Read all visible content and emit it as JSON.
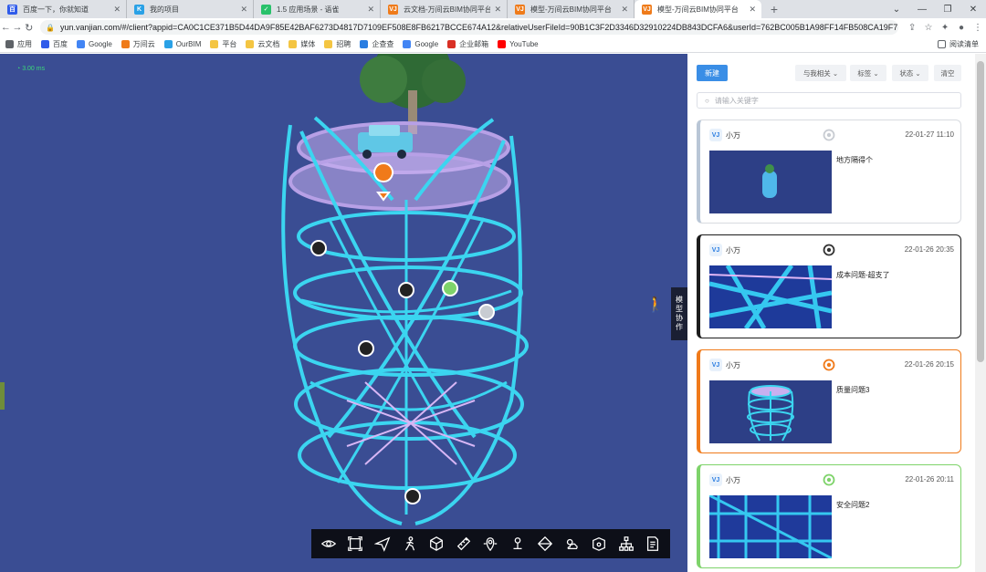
{
  "tabs": [
    {
      "title": "百度一下，你就知道",
      "fav_color": "#2f5bea",
      "fav_glyph": "百"
    },
    {
      "title": "我的项目",
      "fav_color": "#2aa1e6",
      "fav_glyph": "K"
    },
    {
      "title": "1.5 应用场景 - 语雀",
      "fav_color": "#29c16a",
      "fav_glyph": "✓"
    },
    {
      "title": "云文档-万间云BIM协同平台",
      "fav_color": "#ef7b1a",
      "fav_glyph": "VJ"
    },
    {
      "title": "模型-万间云BIM协同平台",
      "fav_color": "#ef7b1a",
      "fav_glyph": "VJ"
    },
    {
      "title": "模型-万间云BIM协同平台",
      "fav_color": "#ef7b1a",
      "fav_glyph": "VJ",
      "active": true
    }
  ],
  "address": {
    "url": "yun.vanjian.com/#/client?appid=CA0C1CE371B5D44DA9F85E42BAF6273D4817D7109EF508E8FB6217BCCE674A12&relativeUserFileId=90B1C3F2D3346D32910224DB843DCFA6&userId=762BC005B1A98FF14FB508CA19F7DB8A6..."
  },
  "bookmarks": [
    {
      "label": "应用",
      "color": "#5f6368"
    },
    {
      "label": "百度",
      "color": "#2f5bea"
    },
    {
      "label": "Google",
      "color": "#4285f4"
    },
    {
      "label": "万间云",
      "color": "#ef7b1a"
    },
    {
      "label": "OurBIM",
      "color": "#2aa1e6"
    },
    {
      "label": "平台",
      "color": "#f4c542"
    },
    {
      "label": "云文档",
      "color": "#f4c542"
    },
    {
      "label": "媒体",
      "color": "#f4c542"
    },
    {
      "label": "招聘",
      "color": "#f4c542"
    },
    {
      "label": "企查查",
      "color": "#2a7de1"
    },
    {
      "label": "Google",
      "color": "#4285f4"
    },
    {
      "label": "企业邮箱",
      "color": "#d93025"
    },
    {
      "label": "YouTube",
      "color": "#ff0000"
    }
  ],
  "reader_mode": "阅读清单",
  "viewer": {
    "fps": "3.00 ms",
    "side_tab": [
      "模",
      "型",
      "协",
      "作"
    ]
  },
  "toolbar": [
    {
      "name": "eye"
    },
    {
      "name": "frame"
    },
    {
      "name": "send"
    },
    {
      "name": "walk"
    },
    {
      "name": "cube"
    },
    {
      "name": "ruler"
    },
    {
      "name": "marker"
    },
    {
      "name": "pin"
    },
    {
      "name": "prism"
    },
    {
      "name": "weather"
    },
    {
      "name": "box-view"
    },
    {
      "name": "tree"
    },
    {
      "name": "doc"
    }
  ],
  "panel": {
    "new_label": "新建",
    "filter_related": "与我相关",
    "filter_tag": "标签",
    "filter_status": "状态",
    "clear_label": "清空",
    "search_placeholder": "请输入关键字",
    "cards": [
      {
        "user": "小万",
        "time": "22-01-27 11:10",
        "title": "地方隔得个",
        "accent": "#b9c6d6",
        "mark_color": "#c8ccd2",
        "thumb": "bottle"
      },
      {
        "user": "小万",
        "time": "22-01-26 20:35",
        "title": "成本问题-超支了",
        "accent": "#1c1c1c",
        "mark_color": "#333333",
        "thumb": "beams"
      },
      {
        "user": "小万",
        "time": "22-01-26 20:15",
        "title": "质量问题3",
        "accent": "#f07a1a",
        "mark_color": "#f07a1a",
        "thumb": "tower"
      },
      {
        "user": "小万",
        "time": "22-01-26 20:11",
        "title": "安全问题2",
        "accent": "#7ed36a",
        "mark_color": "#7ed36a",
        "thumb": "grid"
      }
    ]
  }
}
